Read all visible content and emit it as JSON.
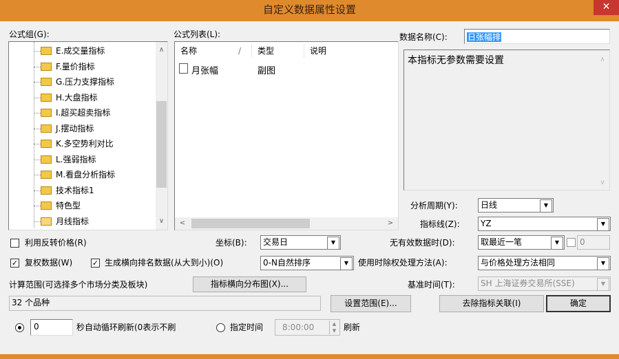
{
  "window": {
    "title": "自定义数据属性设置",
    "close": "✕"
  },
  "formula_group": {
    "label": "公式组(G):",
    "items": [
      {
        "label": "E.成交量指标",
        "open": false
      },
      {
        "label": "F.量价指标",
        "open": false
      },
      {
        "label": "G.压力支撑指标",
        "open": false
      },
      {
        "label": "H.大盘指标",
        "open": false
      },
      {
        "label": "I.超买超卖指标",
        "open": false
      },
      {
        "label": "J.摆动指标",
        "open": false
      },
      {
        "label": "K.多空势利对比",
        "open": false
      },
      {
        "label": "L.强弱指标",
        "open": false
      },
      {
        "label": "M.看盘分析指标",
        "open": false
      },
      {
        "label": "技术指标1",
        "open": false
      },
      {
        "label": "特色型",
        "open": false
      },
      {
        "label": "月线指标",
        "open": true
      }
    ],
    "scroll_up": "∧",
    "scroll_down": "∨"
  },
  "formula_list": {
    "label": "公式列表(L):",
    "columns": [
      "名称",
      "类型",
      "说明"
    ],
    "sort_mark": "/",
    "rows": [
      {
        "name": "月张幅",
        "type": "副图",
        "desc": ""
      }
    ],
    "scroll_left": "<",
    "scroll_right": ">"
  },
  "data_name": {
    "label": "数据名称(C):",
    "value": "日张幅排",
    "description": "本指标无参数需要设置",
    "scroll_up": "∧",
    "scroll_down": "∨"
  },
  "analysis_period": {
    "label": "分析周期(Y):",
    "value": "日线"
  },
  "indicator_line": {
    "label": "指标线(Z):",
    "value": "YZ"
  },
  "reverse_price": {
    "label": "利用反转价格(R)",
    "checked": false
  },
  "axis": {
    "label": "坐标(B):",
    "value": "交易日"
  },
  "no_valid_data": {
    "label": "无有效数据时(D):",
    "value": "取最近一笔",
    "extra": "0"
  },
  "adjusted_data": {
    "label": "复权数据(W)",
    "checked": true
  },
  "rank_data": {
    "label": "生成横向排名数据(从大到小)(O)",
    "checked": true,
    "value": "0-N自然排序"
  },
  "exright_method": {
    "label": "使用时除权处理方法(A):",
    "value": "与价格处理方法相同"
  },
  "calc_range": {
    "label": "计算范围(可选择多个市场分类及板块)",
    "value": "32 个品种"
  },
  "distribution_button": "指标横向分布图(X)...",
  "base_time": {
    "label": "基准时间(T):",
    "value": "SH 上海证券交易所(SSE)"
  },
  "set_range_button": "设置范围(E)...",
  "remove_link_button": "去除指标关联(I)",
  "ok_button": "确定",
  "refresh": {
    "seconds_value": "0",
    "seconds_label": "秒自动循环刷新(0表示不刷",
    "time_label": "指定时间",
    "time_value": "8:00:00",
    "refresh_label": "刷新",
    "seconds_selected": true
  },
  "glyphs": {
    "check": "✓",
    "dropdown": "▼",
    "spin_up": "▲",
    "spin_down": "▼"
  }
}
